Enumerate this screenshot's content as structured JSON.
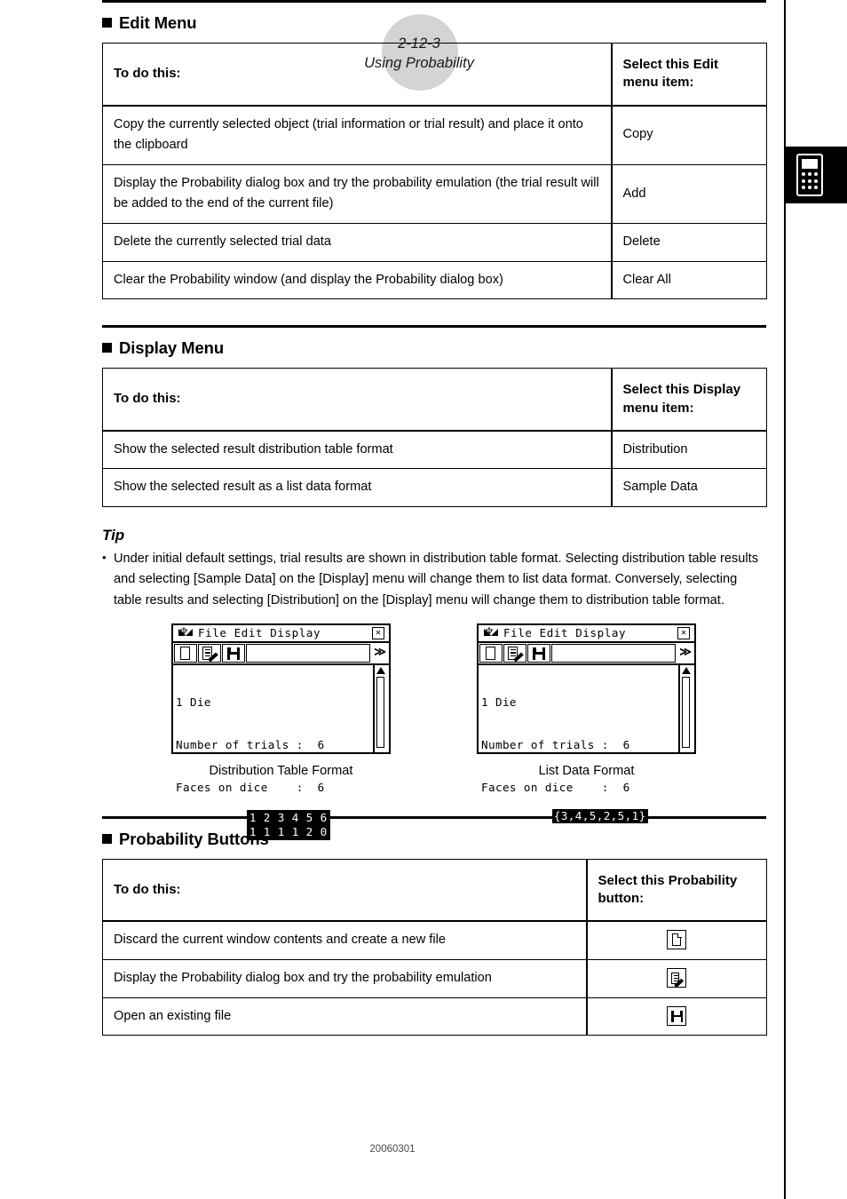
{
  "header": {
    "page_number": "2-12-3",
    "page_title": "Using Probability"
  },
  "side_tab": {
    "icon": "calculator-icon"
  },
  "sections": {
    "edit_menu": {
      "title": "Edit Menu",
      "columns": [
        "To do this:",
        "Select this Edit menu item:"
      ],
      "rows": [
        {
          "action": "Copy the currently selected object (trial information or trial result) and place it onto the clipboard",
          "item": "Copy"
        },
        {
          "action": "Display the Probability dialog box and try the probability emulation (the trial result will be added to the end of the current file)",
          "item": "Add"
        },
        {
          "action": "Delete the currently selected trial data",
          "item": "Delete"
        },
        {
          "action": "Clear the Probability window (and display the Probability dialog box)",
          "item": "Clear All"
        }
      ]
    },
    "display_menu": {
      "title": "Display Menu",
      "columns": [
        "To do this:",
        "Select this Display menu item:"
      ],
      "rows": [
        {
          "action": "Show the selected result distribution table format",
          "item": "Distribution"
        },
        {
          "action": "Show the selected result as a list data format",
          "item": "Sample Data"
        }
      ]
    },
    "probability_buttons": {
      "title": "Probability Buttons",
      "columns": [
        "To do this:",
        "Select this Probability button:"
      ],
      "rows": [
        {
          "action": "Discard the current window contents and create a new file",
          "icon": "new-file-icon"
        },
        {
          "action": "Display the Probability dialog box and try the probability emulation",
          "icon": "probability-dialog-icon"
        },
        {
          "action": "Open an existing file",
          "icon": "open-file-icon"
        }
      ]
    }
  },
  "tip": {
    "heading": "Tip",
    "bullet": "•",
    "text": "Under initial default settings, trial results are shown in distribution table format. Selecting distribution table results and selecting [Sample Data] on the [Display] menu will change them to list data format. Conversely, selecting table results and selecting [Distribution] on the [Display] menu will change them to distribution table format."
  },
  "screenshots": {
    "left": {
      "caption": "Distribution Table Format",
      "titlebar": {
        "app_icon": "♆",
        "menus": "File Edit Display",
        "close": "☒"
      },
      "toolbar": {
        "buttons": [
          "new-file-icon",
          "probability-dialog-icon",
          "open-file-icon"
        ],
        "more": "≫"
      },
      "lines": [
        "1 Die",
        "Number of trials :  6",
        "Faces on dice    :  6"
      ],
      "dist_table_row1": "1 2 3 4 5 6",
      "dist_table_row2": "1 1 1 1 2 0"
    },
    "right": {
      "caption": "List Data Format",
      "titlebar": {
        "app_icon": "♆",
        "menus": "File Edit Display",
        "close": "☒"
      },
      "toolbar": {
        "buttons": [
          "new-file-icon",
          "probability-dialog-icon",
          "open-file-icon"
        ],
        "more": "≫"
      },
      "lines": [
        "1 Die",
        "Number of trials :  6",
        "Faces on dice    :  6"
      ],
      "list_data": "{3,4,5,2,5,1}"
    }
  },
  "footer": {
    "doc_code": "20060301"
  }
}
